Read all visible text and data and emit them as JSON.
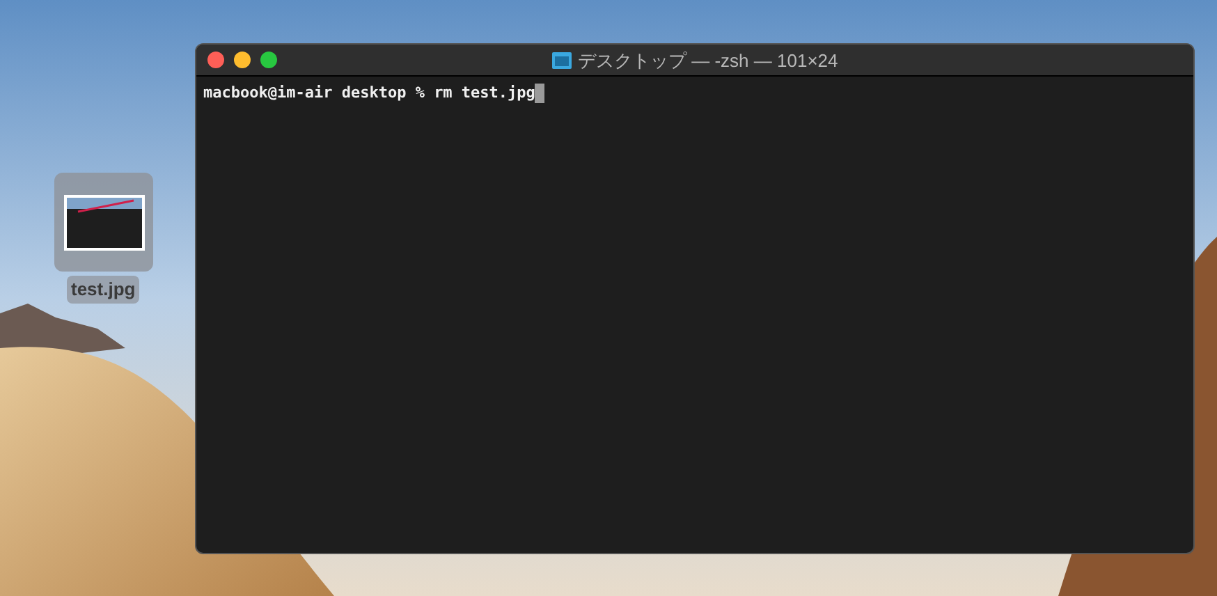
{
  "desktop_icons": [
    {
      "label": "test.jpg",
      "selected": true
    }
  ],
  "window": {
    "title": "デスクトップ — -zsh — 101×24",
    "lines": [
      "macbook@im-air desktop % rm test.jpg"
    ]
  }
}
